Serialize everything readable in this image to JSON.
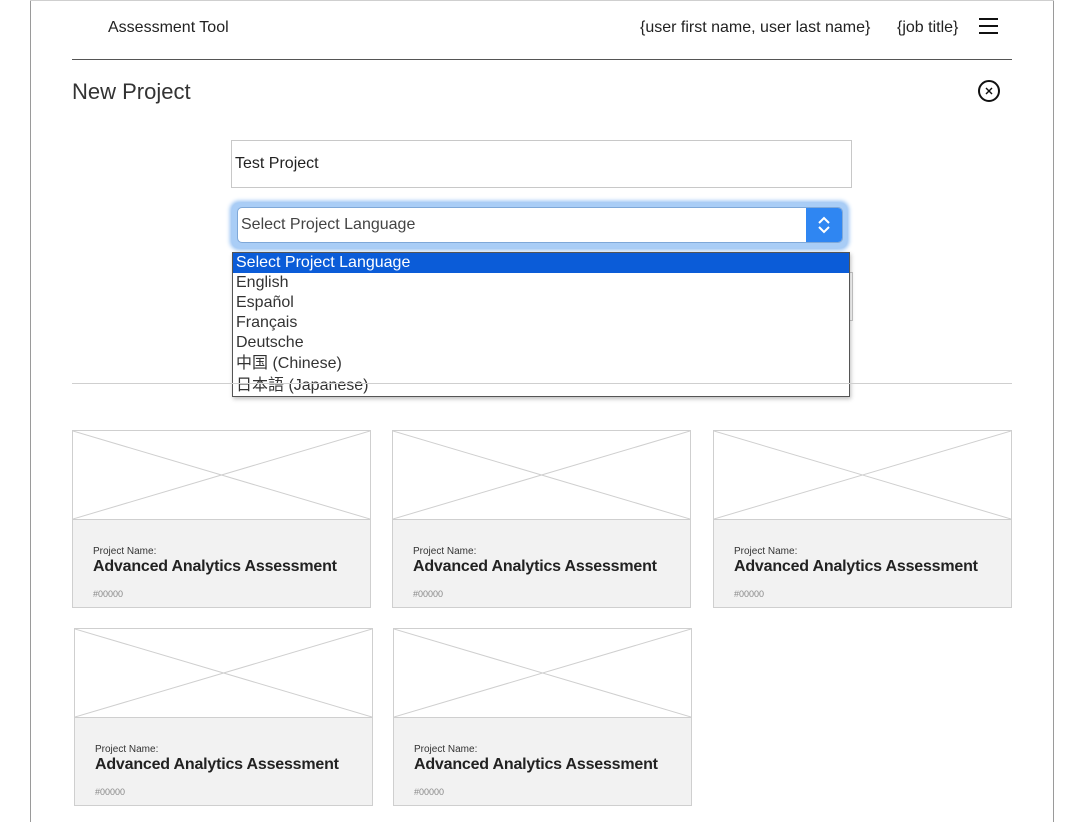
{
  "header": {
    "app_title": "Assessment Tool",
    "user_name": "{user first name, user last name}",
    "job_title": "{job title}",
    "menu_icon": "hamburger-menu-icon"
  },
  "panel": {
    "title": "New Project",
    "close_icon": "close-circle-icon"
  },
  "form": {
    "project_name_value": "Test Project",
    "language_select": {
      "selected": "Select Project Language",
      "options": [
        "Select Project Language",
        "English",
        "Español",
        "Français",
        "Deutsche",
        "中国 (Chinese)",
        "日本語 (Japanese)"
      ]
    }
  },
  "projects": [
    {
      "label": "Project Name:",
      "name": "Advanced Analytics Assessment",
      "id": "#00000"
    },
    {
      "label": "Project Name:",
      "name": "Advanced Analytics Assessment",
      "id": "#00000"
    },
    {
      "label": "Project Name:",
      "name": "Advanced Analytics Assessment",
      "id": "#00000"
    },
    {
      "label": "Project Name:",
      "name": "Advanced Analytics Assessment",
      "id": "#00000"
    },
    {
      "label": "Project Name:",
      "name": "Advanced Analytics Assessment",
      "id": "#00000"
    }
  ],
  "colors": {
    "accent": "#2f86f2",
    "selected_option": "#0b5cd8",
    "card_info_bg": "#f2f2f2"
  }
}
